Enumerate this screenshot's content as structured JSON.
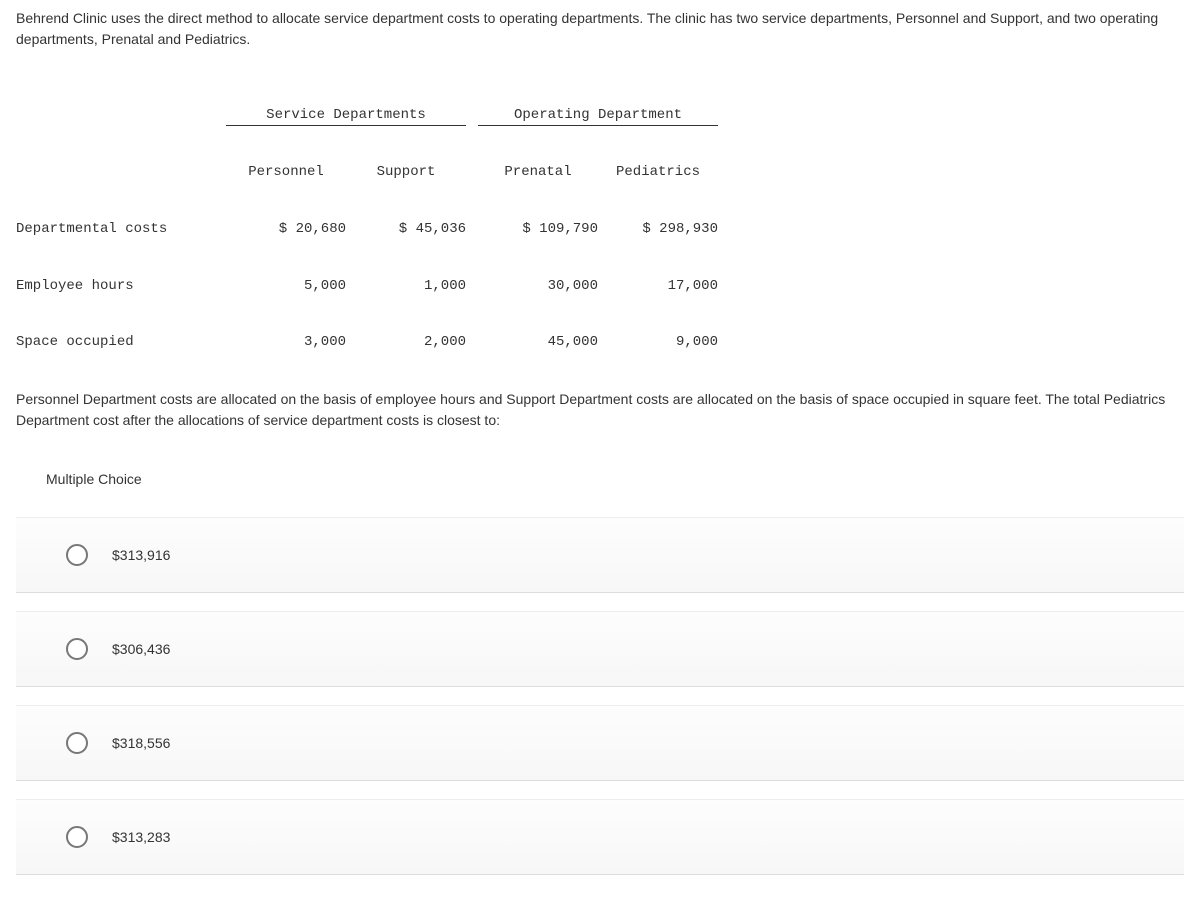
{
  "intro": "Behrend Clinic uses the direct method to allocate service department costs to operating departments. The clinic has two service departments, Personnel and Support, and two operating departments, Prenatal and Pediatrics.",
  "table": {
    "group_headers": {
      "service": "Service Departments",
      "operating": "Operating Department"
    },
    "col_headers": {
      "personnel": "Personnel",
      "support": "Support",
      "prenatal": "Prenatal",
      "pediatrics": "Pediatrics"
    },
    "rows": [
      {
        "label": "Departmental costs",
        "personnel": "$ 20,680",
        "support": "$ 45,036",
        "prenatal": "$ 109,790",
        "pediatrics": "$ 298,930"
      },
      {
        "label": "Employee hours",
        "personnel": "5,000",
        "support": "1,000",
        "prenatal": "30,000",
        "pediatrics": "17,000"
      },
      {
        "label": "Space occupied",
        "personnel": "3,000",
        "support": "2,000",
        "prenatal": "45,000",
        "pediatrics": "9,000"
      }
    ]
  },
  "body": "Personnel Department costs are allocated on the basis of employee hours and Support Department costs are allocated on the basis of space occupied in square feet. The total Pediatrics Department cost after the allocations of service department costs is closest to:",
  "mc_label": "Multiple Choice",
  "choices": [
    {
      "text": "$313,916"
    },
    {
      "text": "$306,436"
    },
    {
      "text": "$318,556"
    },
    {
      "text": "$313,283"
    }
  ]
}
